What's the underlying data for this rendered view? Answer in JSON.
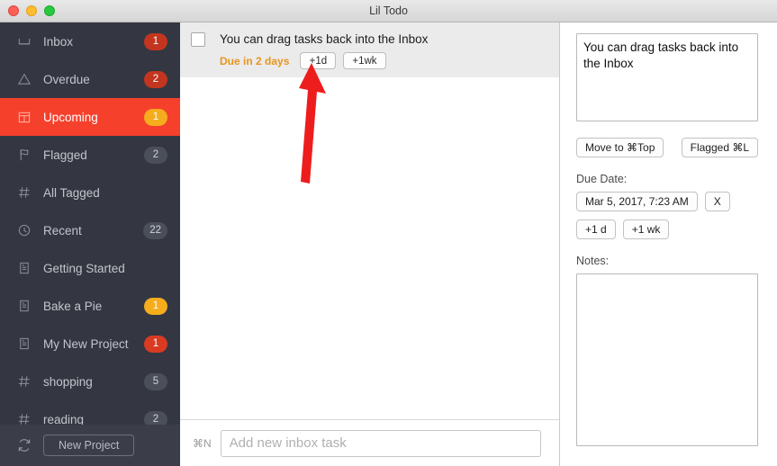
{
  "window": {
    "title": "Lil Todo",
    "traffic_lights": [
      "close-button",
      "minimize-button",
      "maximize-button"
    ]
  },
  "colors": {
    "sidebar_bg": "#343741",
    "selected_row": "#f5402c",
    "badge_red": "#c4351f",
    "badge_amber": "#f5ad1d",
    "badge_gray": "#4b4f5a",
    "due_text": "#e8951d",
    "annotation_arrow": "#ee1d1d"
  },
  "sidebar": {
    "items": [
      {
        "label": "Inbox",
        "icon": "inbox-icon",
        "badge": "1",
        "badge_style": "red",
        "selected": false
      },
      {
        "label": "Overdue",
        "icon": "warning-icon",
        "badge": "2",
        "badge_style": "red",
        "selected": false
      },
      {
        "label": "Upcoming",
        "icon": "calendar-icon",
        "badge": "1",
        "badge_style": "amber",
        "selected": true
      },
      {
        "label": "Flagged",
        "icon": "flag-icon",
        "badge": "2",
        "badge_style": "gray",
        "selected": false
      },
      {
        "label": "All Tagged",
        "icon": "hash-icon",
        "badge": "",
        "badge_style": "none",
        "selected": false
      },
      {
        "label": "Recent",
        "icon": "clock-icon",
        "badge": "22",
        "badge_style": "gray",
        "selected": false
      },
      {
        "label": "Getting Started",
        "icon": "project-icon",
        "badge": "",
        "badge_style": "none",
        "selected": false
      },
      {
        "label": "Bake a Pie",
        "icon": "project-icon",
        "badge": "1",
        "badge_style": "amber",
        "selected": false
      },
      {
        "label": "My New Project",
        "icon": "project-icon",
        "badge": "1",
        "badge_style": "redbright",
        "selected": false
      },
      {
        "label": "shopping",
        "icon": "hash-icon",
        "badge": "5",
        "badge_style": "gray",
        "selected": false
      },
      {
        "label": "reading",
        "icon": "hash-icon",
        "badge": "2",
        "badge_style": "gray",
        "selected": false
      }
    ],
    "footer": {
      "sync_icon": "sync-icon",
      "new_project_label": "New Project"
    }
  },
  "tasklist": {
    "tasks": [
      {
        "title": "You can drag tasks back into the Inbox",
        "checked": false,
        "due_label": "Due in 2 days",
        "snooze_buttons": [
          "+1d",
          "+1wk"
        ],
        "selected": true
      }
    ],
    "addbar": {
      "shortcut": "⌘N",
      "placeholder": "Add new inbox task",
      "value": ""
    }
  },
  "inspector": {
    "title_value": "You can drag tasks back into the Inbox",
    "move_to_top_label": "Move to ⌘Top",
    "flagged_label": "Flagged ⌘L",
    "due_date_label": "Due Date:",
    "due_date_value": "Mar 5, 2017, 7:23 AM",
    "clear_due_label": "X",
    "due_increments": [
      "+1 d",
      "+1 wk"
    ],
    "notes_label": "Notes:",
    "notes_value": ""
  },
  "annotation": {
    "type": "arrow",
    "points_to": "+1d",
    "color": "#ee1d1d"
  }
}
